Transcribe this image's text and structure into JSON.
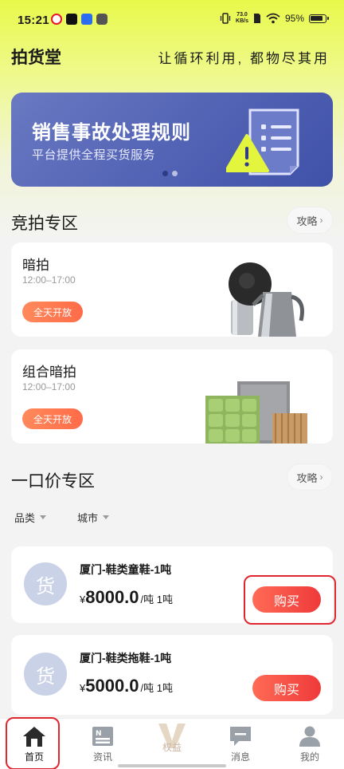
{
  "status_bar": {
    "time": "15:21",
    "net_speed_value": "73.0",
    "net_speed_unit": "KB/s",
    "battery": "95%"
  },
  "header": {
    "brand": "拍货堂",
    "slogan": "让循环利用, 都物尽其用"
  },
  "banner": {
    "title": "销售事故处理规则",
    "subtitle": "平台提供全程买货服务",
    "colors": {
      "start": "#6a79c2",
      "end": "#3f51a8",
      "warning": "#e4f53d"
    }
  },
  "auction": {
    "title": "竞拍专区",
    "guide_label": "攻略",
    "cards": [
      {
        "name": "暗拍",
        "hours": "12:00–17:00",
        "tag": "全天开放"
      },
      {
        "name": "组合暗拍",
        "hours": "12:00–17:00",
        "tag": "全天开放"
      }
    ]
  },
  "fixed_price": {
    "title": "一口价专区",
    "guide_label": "攻略",
    "filters": [
      "品类",
      "城市"
    ],
    "products": [
      {
        "avatar": "货",
        "title": "厦门-鞋类童鞋-1吨",
        "currency": "¥",
        "amount": "8000.0",
        "unit": "/吨 1吨",
        "buy_label": "购买"
      },
      {
        "avatar": "货",
        "title": "厦门-鞋类拖鞋-1吨",
        "currency": "¥",
        "amount": "5000.0",
        "unit": "/吨 1吨",
        "buy_label": "购买"
      }
    ]
  },
  "bottom_nav": {
    "items": [
      {
        "label": "首页",
        "icon": "home-icon"
      },
      {
        "label": "资讯",
        "icon": "news-icon"
      },
      {
        "label": "权益",
        "icon": "vip-icon"
      },
      {
        "label": "消息",
        "icon": "message-icon"
      },
      {
        "label": "我的",
        "icon": "profile-icon"
      }
    ],
    "active_index": 0
  },
  "accent_colors": {
    "buy": "#ef3a3a",
    "tag": "#ff6b48",
    "highlight": "#e0262e"
  }
}
